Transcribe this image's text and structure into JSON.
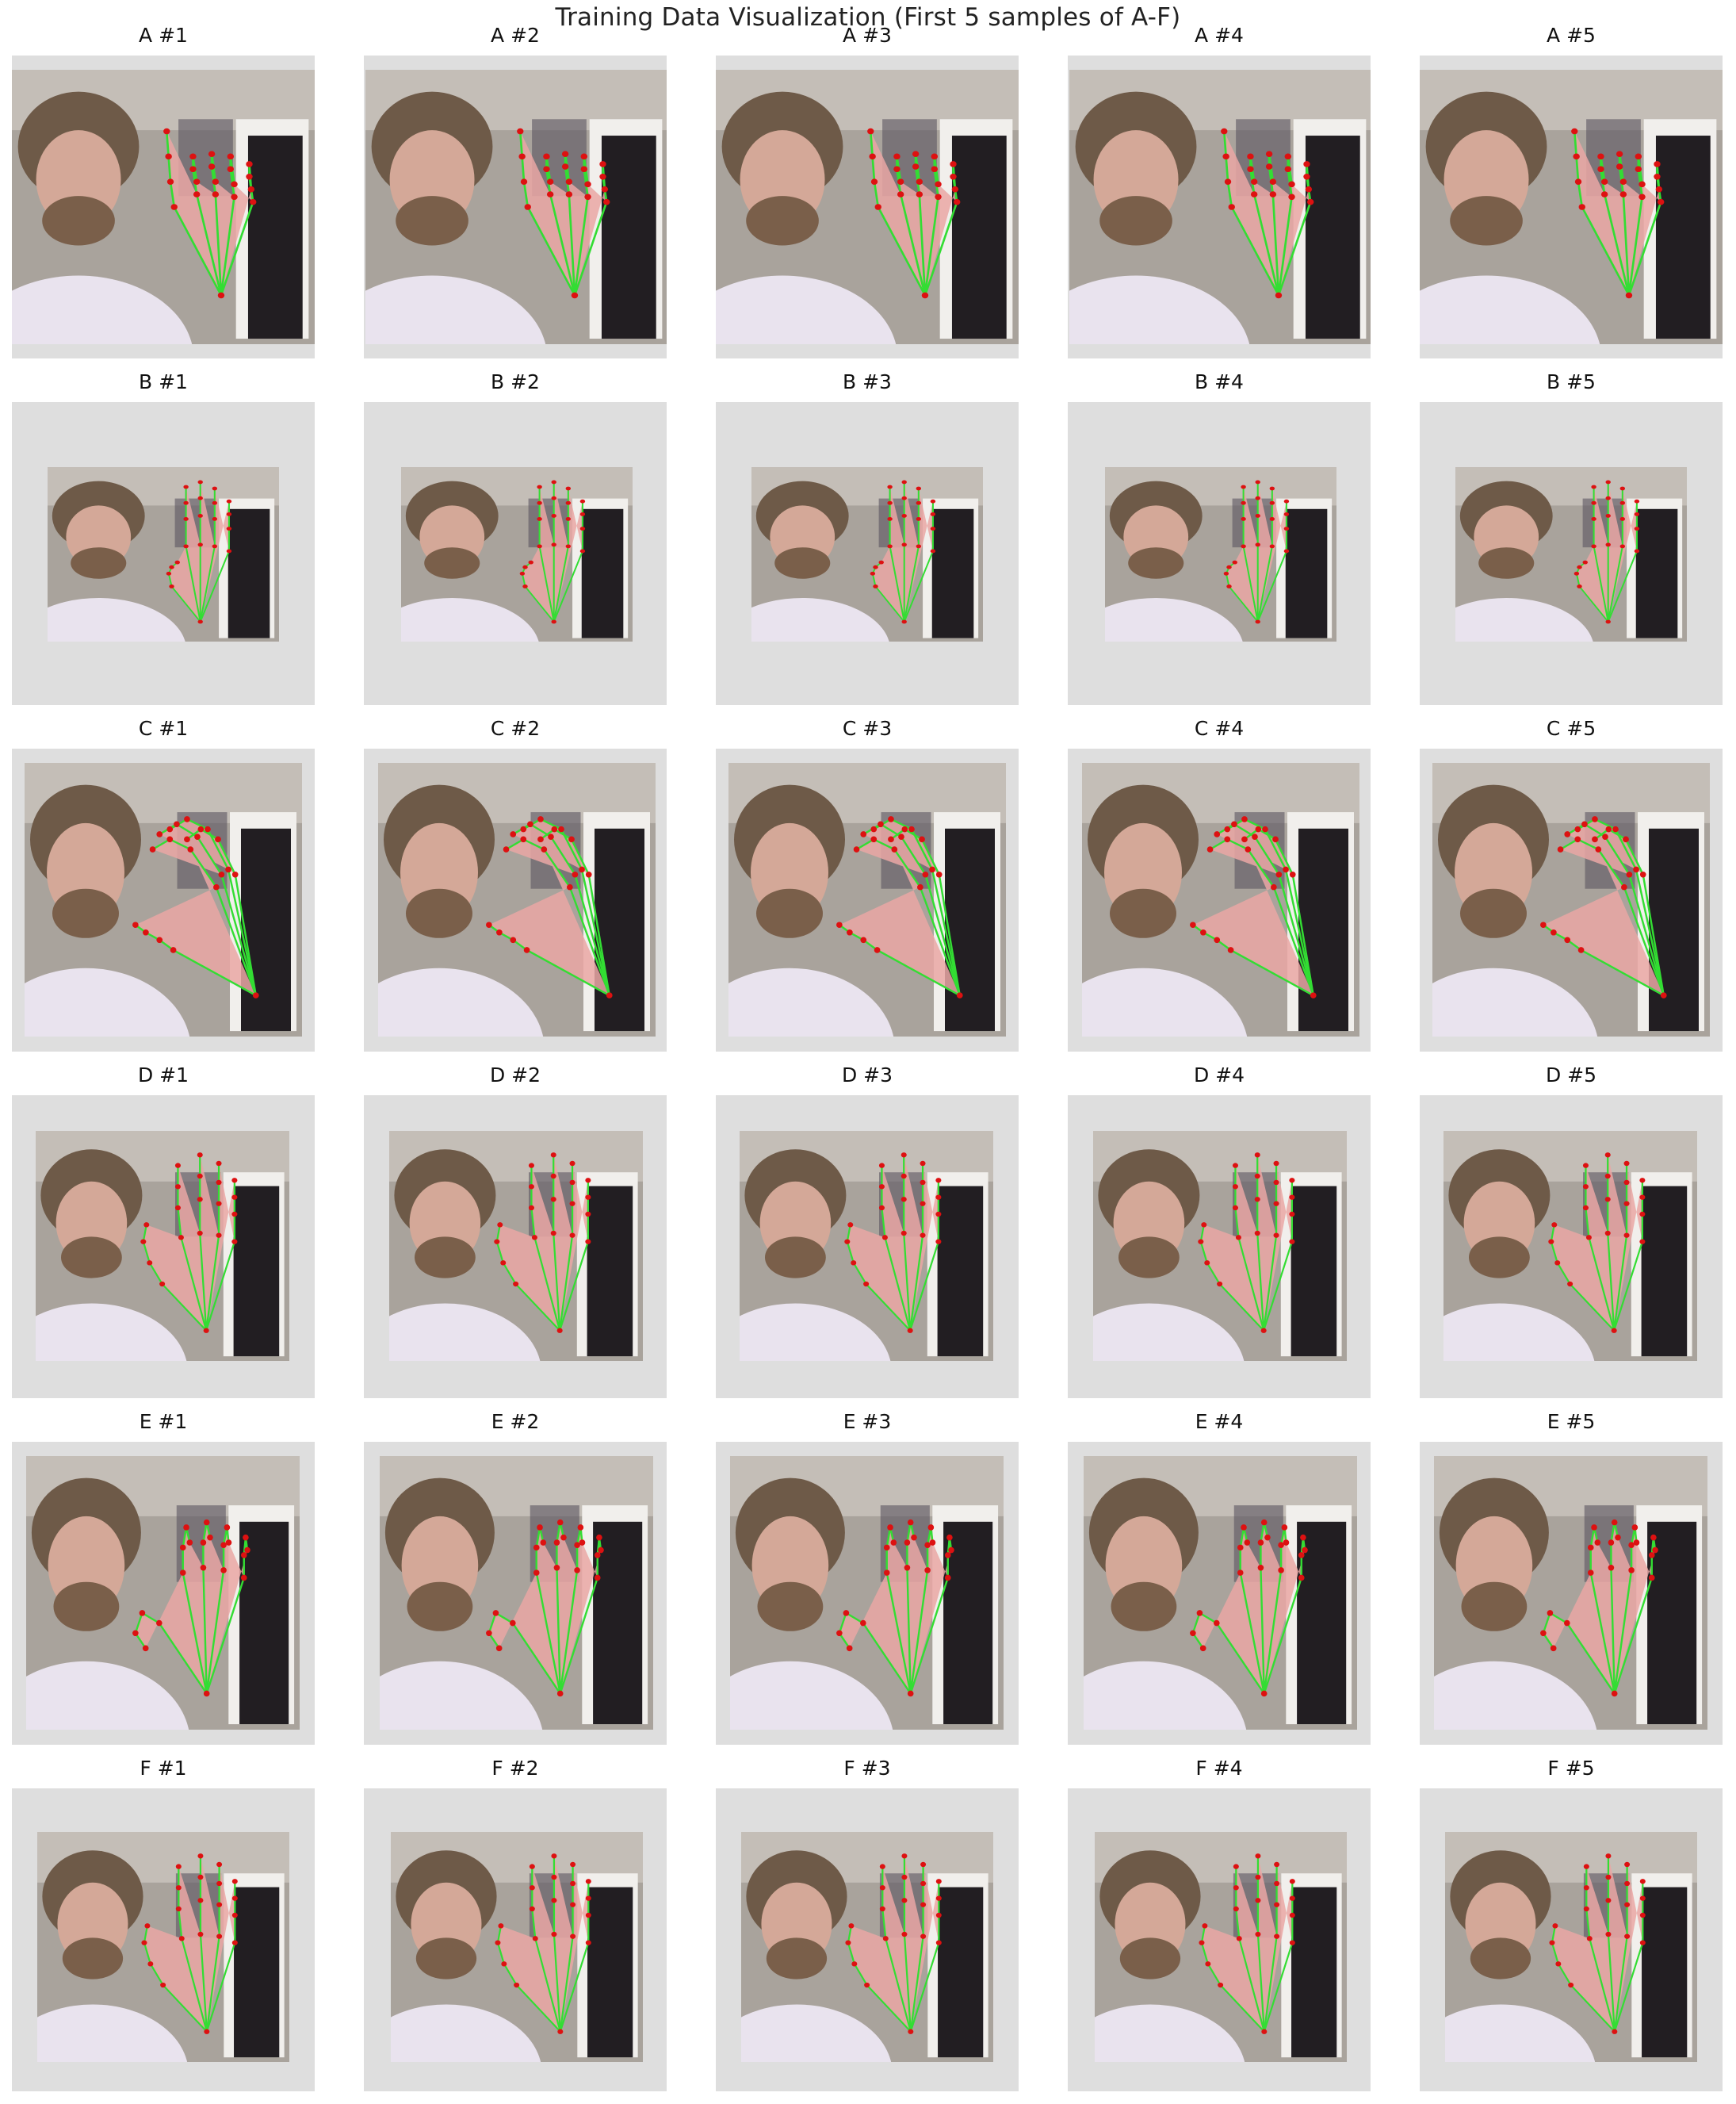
{
  "figure": {
    "title": "Training Data Visualization (First 5 samples of A-F)"
  },
  "colors": {
    "background": "#ffffff",
    "padding": "#dedede",
    "landmark_line": "#33dd33",
    "landmark_point": "#dd1111"
  },
  "rows": [
    {
      "letter": "A",
      "pose": "fist",
      "samples": [
        {
          "title": "A #1"
        },
        {
          "title": "A #2"
        },
        {
          "title": "A #3"
        },
        {
          "title": "A #4"
        },
        {
          "title": "A #5"
        }
      ]
    },
    {
      "letter": "B",
      "pose": "flat",
      "samples": [
        {
          "title": "B #1"
        },
        {
          "title": "B #2"
        },
        {
          "title": "B #3"
        },
        {
          "title": "B #4"
        },
        {
          "title": "B #5"
        }
      ]
    },
    {
      "letter": "C",
      "pose": "curve",
      "samples": [
        {
          "title": "C #1"
        },
        {
          "title": "C #2"
        },
        {
          "title": "C #3"
        },
        {
          "title": "C #4"
        },
        {
          "title": "C #5"
        }
      ]
    },
    {
      "letter": "D",
      "pose": "open",
      "samples": [
        {
          "title": "D #1"
        },
        {
          "title": "D #2"
        },
        {
          "title": "D #3"
        },
        {
          "title": "D #4"
        },
        {
          "title": "D #5"
        }
      ]
    },
    {
      "letter": "E",
      "pose": "claw",
      "samples": [
        {
          "title": "E #1"
        },
        {
          "title": "E #2"
        },
        {
          "title": "E #3"
        },
        {
          "title": "E #4"
        },
        {
          "title": "E #5"
        }
      ]
    },
    {
      "letter": "F",
      "pose": "open",
      "samples": [
        {
          "title": "F #1"
        },
        {
          "title": "F #2"
        },
        {
          "title": "F #3"
        },
        {
          "title": "F #4"
        },
        {
          "title": "F #5"
        }
      ]
    }
  ]
}
